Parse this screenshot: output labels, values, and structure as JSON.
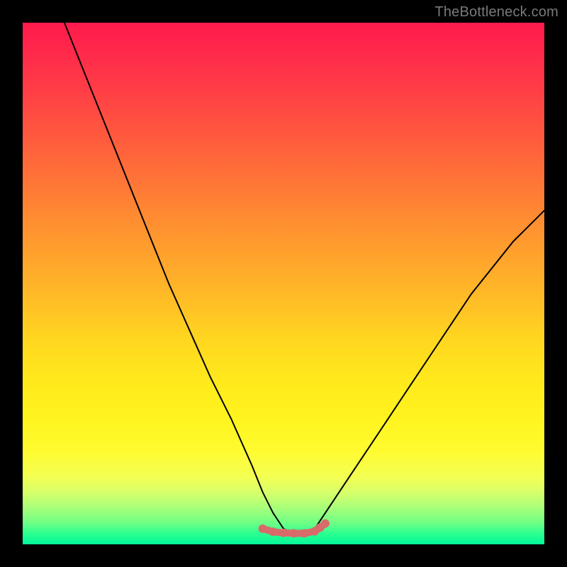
{
  "watermark": "TheBottleneck.com",
  "chart_data": {
    "type": "line",
    "title": "",
    "xlabel": "",
    "ylabel": "",
    "xlim": [
      0,
      100
    ],
    "ylim": [
      0,
      100
    ],
    "grid": false,
    "legend": false,
    "series": [
      {
        "name": "curve",
        "color": "#000000",
        "x": [
          8,
          12,
          16,
          20,
          24,
          28,
          32,
          36,
          40,
          44,
          46,
          48,
          50,
          52,
          54,
          56,
          58,
          62,
          66,
          70,
          74,
          78,
          82,
          86,
          90,
          94,
          98,
          100
        ],
        "y": [
          100,
          90,
          80,
          70,
          60,
          50,
          41,
          32,
          24,
          15,
          10,
          6,
          3,
          2,
          2,
          3,
          6,
          12,
          18,
          24,
          30,
          36,
          42,
          48,
          53,
          58,
          62,
          64
        ]
      },
      {
        "name": "bottom-marks",
        "color": "#d86a6a",
        "type": "scatter",
        "x": [
          46,
          48,
          50,
          52,
          54,
          56,
          57,
          58
        ],
        "y": [
          3.0,
          2.4,
          2.2,
          2.1,
          2.1,
          2.5,
          3.2,
          4.0
        ]
      }
    ],
    "gradient_stops": [
      {
        "pos": 0,
        "color": "#ff1a4d"
      },
      {
        "pos": 50,
        "color": "#ffb927"
      },
      {
        "pos": 80,
        "color": "#fffb30"
      },
      {
        "pos": 100,
        "color": "#04f79a"
      }
    ]
  }
}
